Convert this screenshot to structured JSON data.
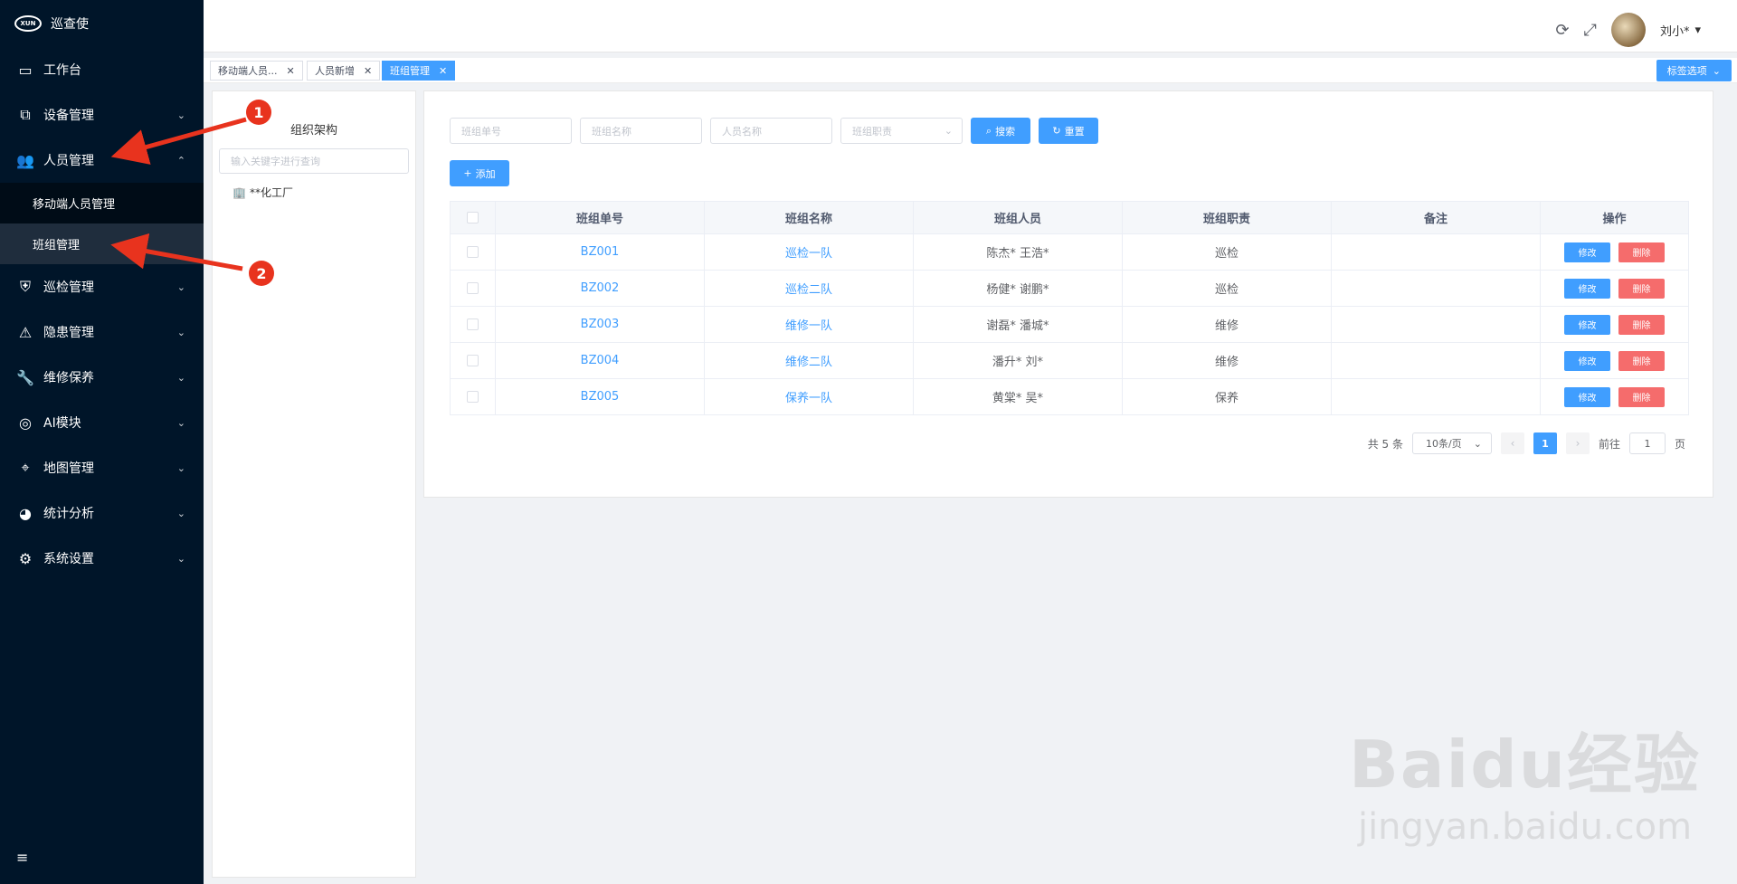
{
  "app": {
    "title": "巡查使",
    "logo_text": "XUN"
  },
  "sidebar": {
    "items": [
      {
        "label": "工作台",
        "icon": "monitor-icon"
      },
      {
        "label": "设备管理",
        "icon": "devices-icon"
      },
      {
        "label": "人员管理",
        "icon": "users-icon"
      },
      {
        "label": "巡检管理",
        "icon": "shield-icon"
      },
      {
        "label": "隐患管理",
        "icon": "warning-icon"
      },
      {
        "label": "维修保养",
        "icon": "wrench-icon"
      },
      {
        "label": "AI模块",
        "icon": "camera-icon"
      },
      {
        "label": "地图管理",
        "icon": "map-pin-icon"
      },
      {
        "label": "统计分析",
        "icon": "pie-chart-icon"
      },
      {
        "label": "系统设置",
        "icon": "gear-icon"
      }
    ],
    "submenu": [
      {
        "label": "移动端人员管理",
        "active": false
      },
      {
        "label": "班组管理",
        "active": true
      }
    ]
  },
  "header": {
    "username": "刘小*"
  },
  "tags": [
    {
      "label": "移动端人员..."
    },
    {
      "label": "人员新增"
    },
    {
      "label": "班组管理",
      "active": true
    }
  ],
  "tag_options_label": "标签选项",
  "tree": {
    "title": "组织架构",
    "search_placeholder": "输入关键字进行查询",
    "root": "**化工厂"
  },
  "filters": {
    "code_placeholder": "班组单号",
    "name_placeholder": "班组名称",
    "person_placeholder": "人员名称",
    "duty_placeholder": "班组职责",
    "search_label": "搜索",
    "reset_label": "重置",
    "add_label": "添加"
  },
  "table": {
    "columns": [
      "班组单号",
      "班组名称",
      "班组人员",
      "班组职责",
      "备注",
      "操作"
    ],
    "rows": [
      {
        "code": "BZ001",
        "name": "巡检一队",
        "members": "陈杰* 王浩*",
        "duty": "巡检",
        "note": ""
      },
      {
        "code": "BZ002",
        "name": "巡检二队",
        "members": "杨健* 谢鹏*",
        "duty": "巡检",
        "note": ""
      },
      {
        "code": "BZ003",
        "name": "维修一队",
        "members": "谢磊* 潘城*",
        "duty": "维修",
        "note": ""
      },
      {
        "code": "BZ004",
        "name": "维修二队",
        "members": "潘升* 刘*",
        "duty": "维修",
        "note": ""
      },
      {
        "code": "BZ005",
        "name": "保养一队",
        "members": "黄棠* 吴*",
        "duty": "保养",
        "note": ""
      }
    ],
    "edit_label": "修改",
    "delete_label": "删除"
  },
  "pagination": {
    "total": "共 5 条",
    "page_size": "10条/页",
    "current_page": "1",
    "goto_prefix": "前往",
    "goto_value": "1",
    "goto_suffix": "页"
  },
  "annotations": {
    "badge1": "1",
    "badge2": "2"
  },
  "watermark": {
    "logo": "Baidu经验",
    "url": "jingyan.baidu.com"
  },
  "colors": {
    "sidebar_bg": "#001529",
    "primary": "#409eff",
    "danger": "#f56c6c",
    "annotation": "#e8331e"
  }
}
